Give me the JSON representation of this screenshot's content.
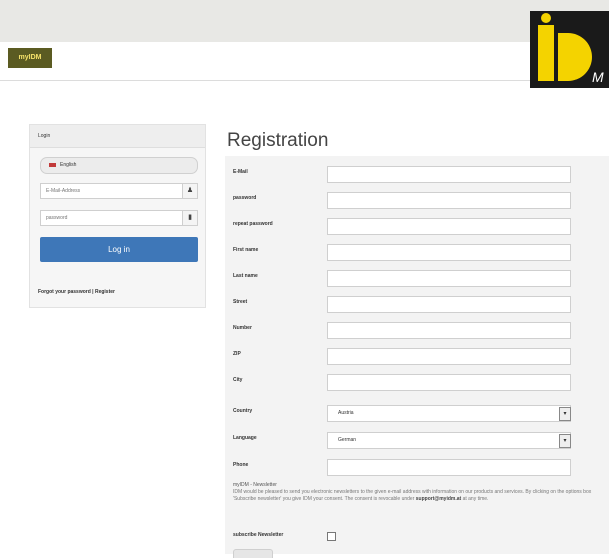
{
  "header": {
    "brand_label": "myIDM",
    "logo_letters": "iD",
    "logo_small": "M"
  },
  "login": {
    "title": "Login",
    "language": "English",
    "email_placeholder": "E-Mail-Address",
    "password_placeholder": "password",
    "button_label": "Log in",
    "forgot_label": "Forgot your password",
    "separator": "|",
    "register_label": "Register"
  },
  "registration": {
    "title": "Registration",
    "fields": [
      {
        "label": "E-Mail",
        "value": ""
      },
      {
        "label": "password",
        "value": ""
      },
      {
        "label": "repeat password",
        "value": ""
      },
      {
        "label": "First name",
        "value": ""
      },
      {
        "label": "Last name",
        "value": ""
      },
      {
        "label": "Street",
        "value": ""
      },
      {
        "label": "Number",
        "value": ""
      },
      {
        "label": "ZIP",
        "value": ""
      },
      {
        "label": "City",
        "value": ""
      }
    ],
    "country": {
      "label": "Country",
      "value": "Austria"
    },
    "language": {
      "label": "Language",
      "value": "German"
    },
    "phone": {
      "label": "Phone",
      "value": ""
    },
    "newsletter": {
      "title": "myIDM - Newsletter",
      "text_before": "IDM would be pleased to send you electronic newsletters to the given e-mail address with information on our products and services. By clicking on the options box 'Subscribe newsletter' you give IDM your consent. The consent is revocable under",
      "email": "support@myidm.at",
      "text_after": "at any time.",
      "subscribe_label": "subscribe Newsletter"
    }
  },
  "icons": {
    "user": "user-icon",
    "lock": "lock-icon",
    "flag": "flag-icon",
    "dropdown": "chevron-down-icon"
  },
  "colors": {
    "login_button": "#3e77b8",
    "logo_yellow": "#f4d300",
    "logo_black": "#1a1a1a"
  }
}
